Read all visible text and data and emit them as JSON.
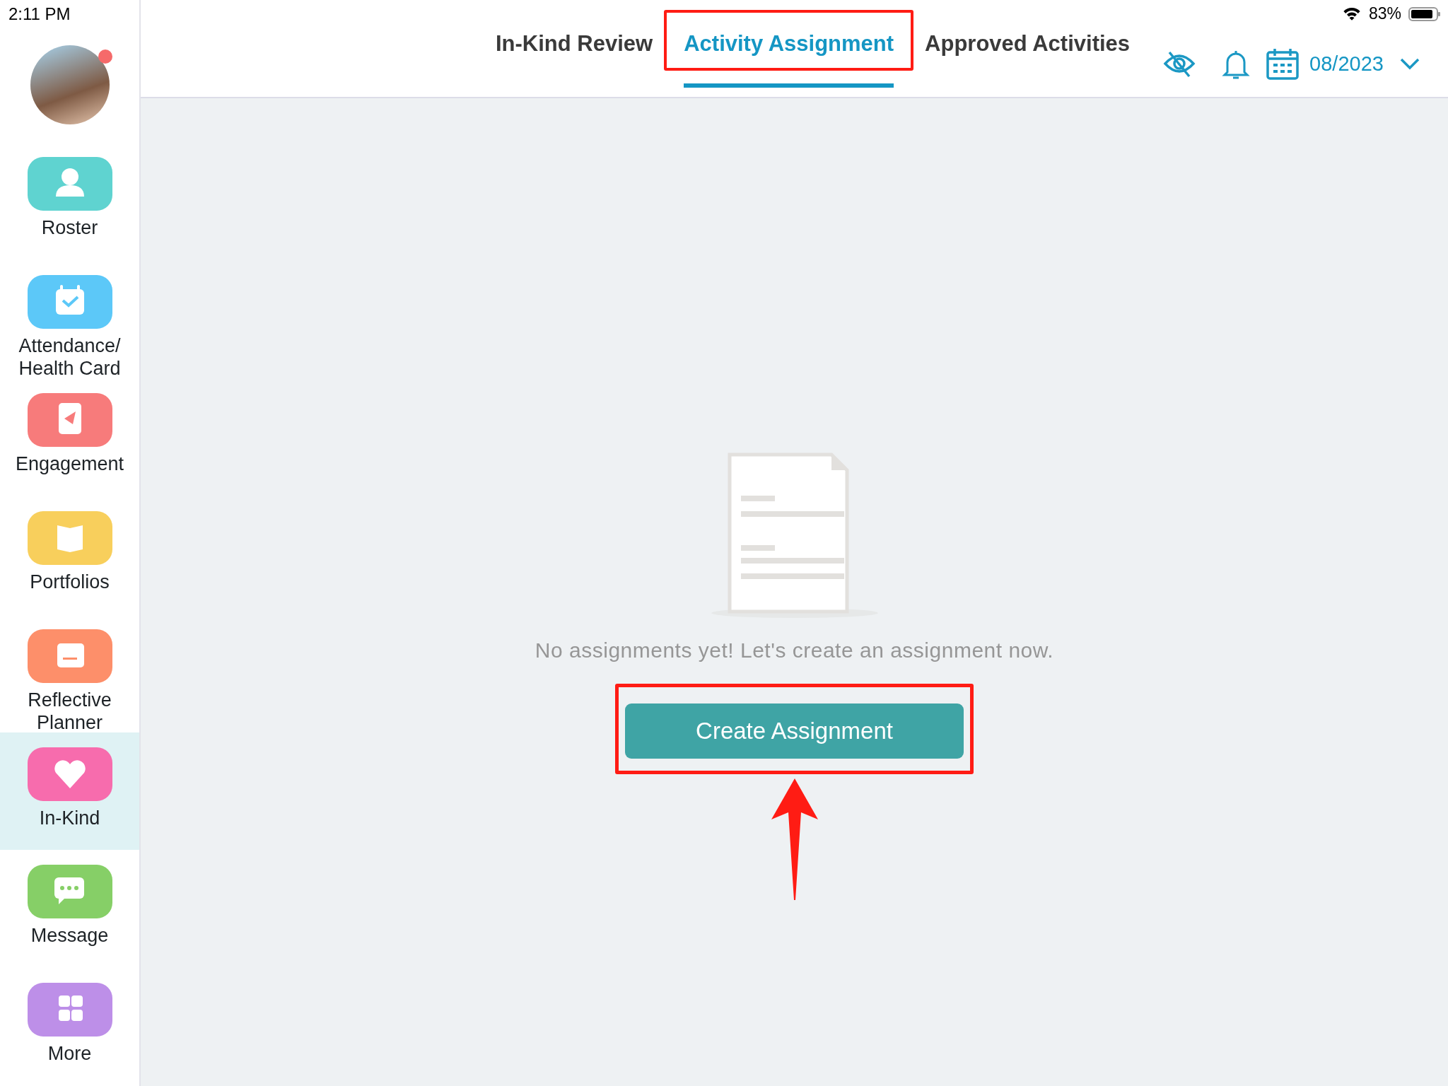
{
  "status_bar": {
    "time": "2:11 PM",
    "battery": "83%"
  },
  "avatar": {
    "has_notification": true
  },
  "sidebar": {
    "items": [
      {
        "label": "Roster",
        "kind": "roster",
        "color": "#5fd3d0",
        "selected": false
      },
      {
        "label": "Attendance/\nHealth Card",
        "kind": "attendance",
        "color": "#5cc8f8",
        "selected": false
      },
      {
        "label": "Engagement",
        "kind": "engagement",
        "color": "#f77b7b",
        "selected": false
      },
      {
        "label": "Portfolios",
        "kind": "portfolios",
        "color": "#f8cf5c",
        "selected": false
      },
      {
        "label": "Reflective\nPlanner",
        "kind": "planner",
        "color": "#fd8f6a",
        "selected": false
      },
      {
        "label": "In-Kind",
        "kind": "inkind",
        "color": "#f76cad",
        "selected": true
      },
      {
        "label": "Message",
        "kind": "message",
        "color": "#86cf67",
        "selected": false
      },
      {
        "label": "More",
        "kind": "more",
        "color": "#bd8fe8",
        "selected": false
      }
    ]
  },
  "tabs": [
    {
      "label": "In-Kind Review",
      "selected": false,
      "highlighted": false
    },
    {
      "label": "Activity Assignment",
      "selected": true,
      "highlighted": true
    },
    {
      "label": "Approved Activities",
      "selected": false,
      "highlighted": false
    }
  ],
  "date_picker": {
    "value": "08/2023"
  },
  "empty_state": {
    "message": "No assignments yet! Let's create an assignment now.",
    "button": {
      "label": "Create Assignment",
      "highlighted": true
    }
  }
}
